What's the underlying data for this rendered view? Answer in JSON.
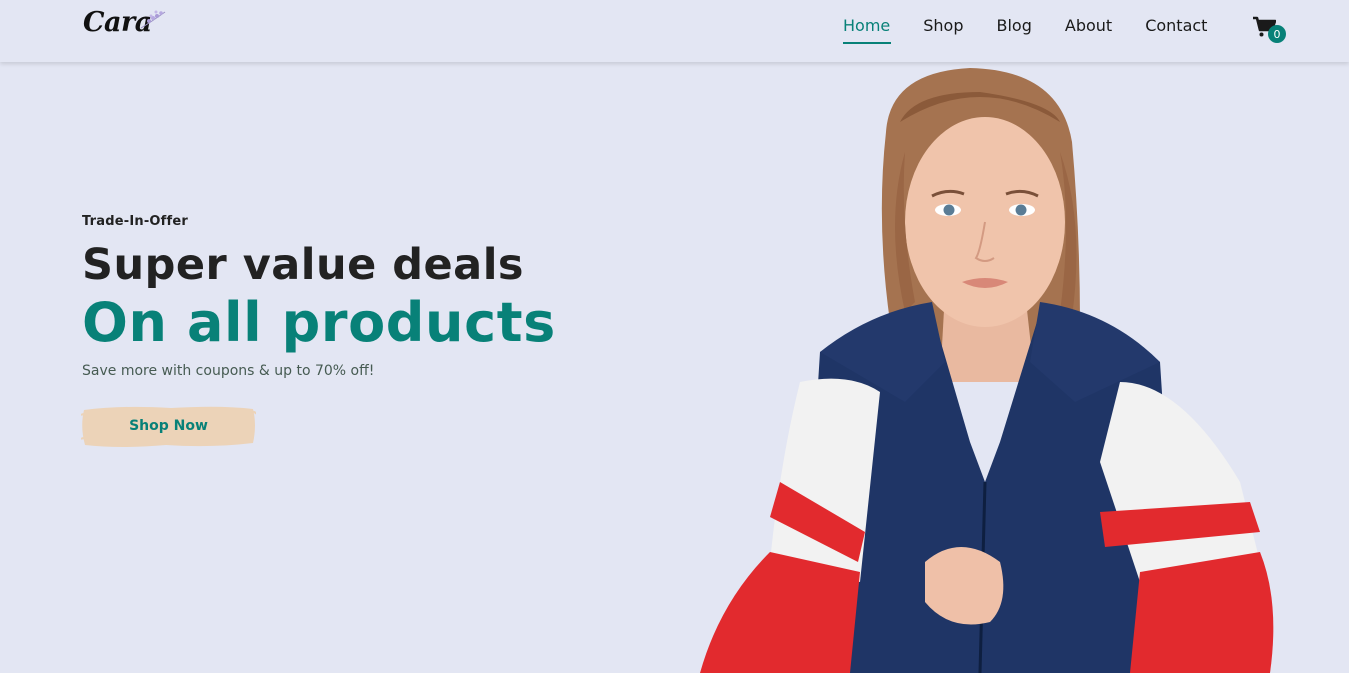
{
  "header": {
    "logo_text": "Cara",
    "nav": [
      {
        "label": "Home",
        "active": true
      },
      {
        "label": "Shop",
        "active": false
      },
      {
        "label": "Blog",
        "active": false
      },
      {
        "label": "About",
        "active": false
      },
      {
        "label": "Contact",
        "active": false
      }
    ],
    "cart_count": "0",
    "icons": {
      "cart": "shopping-cart-icon",
      "logo_flower": "lavender-flower-icon"
    }
  },
  "hero": {
    "eyebrow": "Trade-In-Offer",
    "headline": "Super value deals",
    "subheadline": "On all products",
    "tagline": "Save more with coupons & up to 70% off!",
    "cta_label": "Shop Now"
  },
  "colors": {
    "background": "#e3e6f3",
    "accent": "#088178",
    "button_brush": "#ecd3b8",
    "text_dark": "#222222"
  }
}
